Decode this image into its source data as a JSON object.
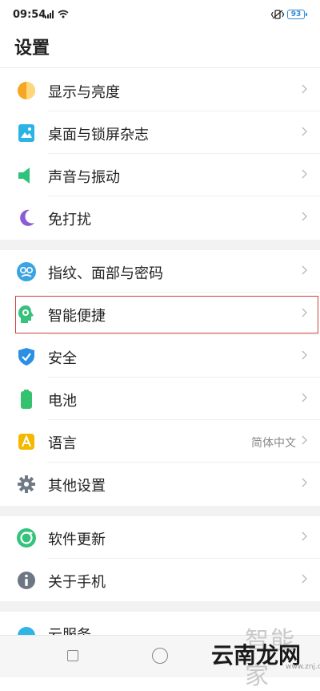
{
  "status_bar": {
    "time": "09:54",
    "signal": "4G",
    "battery": "93"
  },
  "header": {
    "title": "设置"
  },
  "groups": [
    {
      "items": [
        {
          "label": "显示与亮度",
          "icon": "display-brightness-icon"
        },
        {
          "label": "桌面与锁屏杂志",
          "icon": "wallpaper-icon"
        },
        {
          "label": "声音与振动",
          "icon": "sound-icon"
        },
        {
          "label": "免打扰",
          "icon": "moon-icon"
        }
      ]
    },
    {
      "items": [
        {
          "label": "指纹、面部与密码",
          "icon": "fingerprint-face-icon"
        },
        {
          "label": "智能便捷",
          "icon": "smart-assist-icon"
        },
        {
          "label": "安全",
          "icon": "shield-icon"
        },
        {
          "label": "电池",
          "icon": "battery-icon"
        },
        {
          "label": "语言",
          "icon": "language-icon",
          "value": "简体中文"
        },
        {
          "label": "其他设置",
          "icon": "gear-icon"
        }
      ]
    },
    {
      "items": [
        {
          "label": "软件更新",
          "icon": "update-icon"
        },
        {
          "label": "关于手机",
          "icon": "info-icon"
        }
      ]
    },
    {
      "items": [
        {
          "label": "云服务",
          "icon": "cloud-icon"
        }
      ]
    }
  ],
  "watermark": {
    "top_text": "智能家",
    "main_text": "云南龙网",
    "url": "www.znj.com"
  },
  "colors": {
    "highlight_border": "#c8453f",
    "group_gap": "#f2f2f2"
  }
}
